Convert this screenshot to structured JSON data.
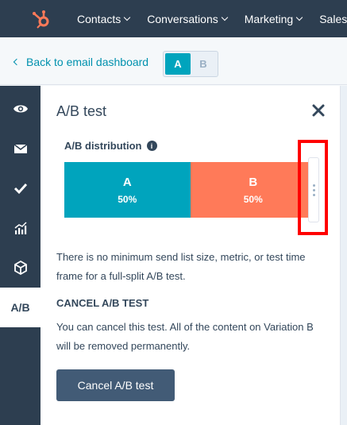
{
  "topnav": {
    "items": [
      {
        "label": "Contacts"
      },
      {
        "label": "Conversations"
      },
      {
        "label": "Marketing"
      },
      {
        "label": "Sales"
      }
    ]
  },
  "subheader": {
    "back_label": "Back to email dashboard",
    "variant_a": "A",
    "variant_b": "B"
  },
  "rail": {
    "items": [
      "eye-icon",
      "envelope-icon",
      "check-icon",
      "chart-icon",
      "cube-icon"
    ],
    "active_label": "A/B"
  },
  "panel": {
    "title": "A/B test",
    "distribution_label": "A/B distribution",
    "variant_a": {
      "label": "A",
      "percent": "50%",
      "share": 0.5
    },
    "variant_b": {
      "label": "B",
      "percent": "50%",
      "share": 0.5
    },
    "note": "There is no minimum send list size, metric, or test time frame for a full-split A/B test.",
    "cancel_heading": "CANCEL A/B TEST",
    "cancel_text": "You can cancel this test. All of the content on Variation B will be removed permanently.",
    "cancel_button": "Cancel A/B test"
  },
  "colors": {
    "nav_bg": "#2d3e50",
    "variant_a": "#00a4bd",
    "variant_b": "#ff7a59",
    "link": "#0091ae",
    "highlight": "#ff0000",
    "button": "#425b76"
  }
}
